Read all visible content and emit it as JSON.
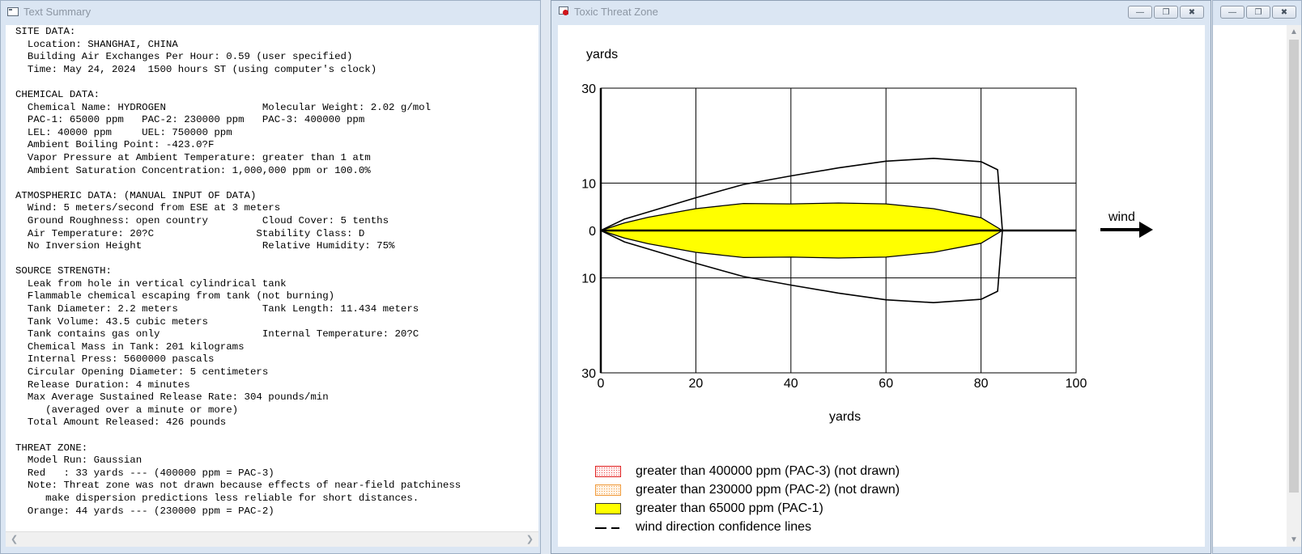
{
  "text_window": {
    "title": "Text Summary",
    "content": "SITE DATA:\n  Location: SHANGHAI, CHINA\n  Building Air Exchanges Per Hour: 0.59 (user specified)\n  Time: May 24, 2024  1500 hours ST (using computer's clock)\n\nCHEMICAL DATA:\n  Chemical Name: HYDROGEN                Molecular Weight: 2.02 g/mol\n  PAC-1: 65000 ppm   PAC-2: 230000 ppm   PAC-3: 400000 ppm\n  LEL: 40000 ppm     UEL: 750000 ppm\n  Ambient Boiling Point: -423.0?F\n  Vapor Pressure at Ambient Temperature: greater than 1 atm\n  Ambient Saturation Concentration: 1,000,000 ppm or 100.0%\n\nATMOSPHERIC DATA: (MANUAL INPUT OF DATA)\n  Wind: 5 meters/second from ESE at 3 meters\n  Ground Roughness: open country         Cloud Cover: 5 tenths\n  Air Temperature: 20?C                 Stability Class: D\n  No Inversion Height                    Relative Humidity: 75%\n\nSOURCE STRENGTH:\n  Leak from hole in vertical cylindrical tank\n  Flammable chemical escaping from tank (not burning)\n  Tank Diameter: 2.2 meters              Tank Length: 11.434 meters\n  Tank Volume: 43.5 cubic meters\n  Tank contains gas only                 Internal Temperature: 20?C\n  Chemical Mass in Tank: 201 kilograms\n  Internal Press: 5600000 pascals\n  Circular Opening Diameter: 5 centimeters\n  Release Duration: 4 minutes\n  Max Average Sustained Release Rate: 304 pounds/min\n     (averaged over a minute or more)\n  Total Amount Released: 426 pounds\n\nTHREAT ZONE:\n  Model Run: Gaussian\n  Red   : 33 yards --- (400000 ppm = PAC-3)\n  Note: Threat zone was not drawn because effects of near-field patchiness\n     make dispersion predictions less reliable for short distances.\n  Orange: 44 yards --- (230000 ppm = PAC-2)"
  },
  "threat_window": {
    "title": "Toxic Threat Zone",
    "legend": [
      {
        "label": "greater than 400000 ppm (PAC-3) (not drawn)",
        "swatch": "red-dotted"
      },
      {
        "label": "greater than 230000 ppm (PAC-2) (not drawn)",
        "swatch": "orange-dotted"
      },
      {
        "label": "greater than 65000 ppm (PAC-1)",
        "swatch": "yellow"
      },
      {
        "label": "wind direction confidence lines",
        "swatch": "dashed-line"
      }
    ],
    "wind_label": "wind"
  },
  "colors": {
    "pac1_fill": "#ffff00",
    "pac3_border": "#e02020",
    "pac2_border": "#f09a3a",
    "title_text": "#8c96a3"
  },
  "chart_data": {
    "type": "area",
    "xlabel": "yards",
    "ylabel": "yards",
    "xlim": [
      0,
      100
    ],
    "ylim": [
      -30,
      30
    ],
    "x_ticks": [
      0,
      20,
      40,
      60,
      80,
      100
    ],
    "y_ticks": [
      30,
      10,
      0,
      10,
      30
    ],
    "y_tick_values": [
      30,
      10,
      0,
      -10,
      -30
    ],
    "series": [
      {
        "name": "greater than 65000 ppm (PAC-1)",
        "x": [
          0,
          5,
          10,
          20,
          30,
          40,
          50,
          60,
          70,
          80,
          84.5
        ],
        "y": [
          0,
          1.6,
          2.8,
          4.6,
          5.7,
          5.6,
          5.8,
          5.6,
          4.6,
          2.7,
          0
        ]
      },
      {
        "name": "wind direction confidence lines",
        "x": [
          0,
          5,
          10,
          20,
          30,
          40,
          50,
          60,
          70,
          80,
          83.5,
          84.5
        ],
        "y": [
          0,
          2.4,
          3.9,
          6.9,
          9.7,
          11.5,
          13.2,
          14.6,
          15.2,
          14.5,
          12.8,
          0
        ]
      }
    ]
  }
}
